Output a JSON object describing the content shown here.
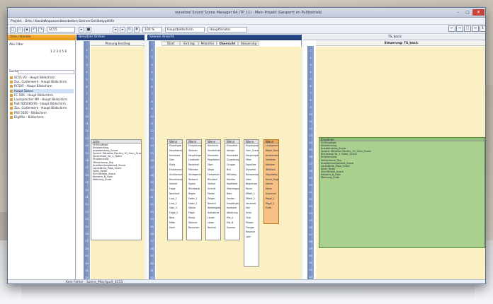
{
  "app": {
    "title": "wavetool Sound Scene Manager 64 (TP 11) - Mein Projekt (Gesperrt im Pultbetrieb)",
    "window_controls": [
      "–",
      "□",
      "✕"
    ]
  },
  "menu": [
    "Projekt",
    "Orte / Kanäle",
    "Anpassen",
    "Bearbeiten",
    "Szenen",
    "Gerätetyp",
    "Hilfe"
  ],
  "toolbar": {
    "scene_combo": "SC55",
    "zoom_combo": "100 %",
    "lang_combo": "Hauptbildschirm",
    "mode_combo": "Hauptfenster"
  },
  "left_panel": {
    "header": "Orte / Kanäle",
    "filter_label": "Alle Filter",
    "channel_counter": "1 2 3 4 5 6",
    "search_label": "Suche",
    "tree": [
      {
        "label": "SC55 V2 - Haupt Bildschirm",
        "selected": false
      },
      {
        "label": "Zus. Codierwerk - Haupt Bildschirm",
        "selected": false
      },
      {
        "label": "RC505 - Haupt Bildschirm",
        "selected": false
      },
      {
        "label": "Haupt Szene",
        "selected": true
      },
      {
        "label": "FC-505 - Haupt Bildschirm",
        "selected": false
      },
      {
        "label": "Lautsprecher MP - Haupt Bildschirm",
        "selected": false
      },
      {
        "label": "Pult RD5000/S5 - Haupt Bildschirm",
        "selected": false
      },
      {
        "label": "Zus. Codierwerk - Haupt Bildschirm",
        "selected": false
      },
      {
        "label": "PSS 5050 - Bildschirm",
        "selected": false
      },
      {
        "label": "DigiMix - Bildschirm",
        "selected": false
      }
    ]
  },
  "mid_panel": {
    "header": "Benutzer Ordner",
    "column_header": "Planung Einstieg",
    "box": {
      "title": "Liste",
      "items": [
        "Hi Eingänge",
        "Einblendung",
        "Ausblendung_Score",
        "Sprech Mikrofon Rechts_10_Gain_Score",
        "Sprechtest_Nr_1_Fader",
        "Einblendung",
        "Fehlstimme_Tag",
        "Ausblendungsband_Score",
        "Lautstärke_Pass_Score",
        "Spiel_Fader",
        "Schnittliste_Score",
        "Kamera_B_Gain",
        "Meldung_Ende"
      ]
    }
  },
  "center_panel": {
    "header": "Szenen Ansicht",
    "tabs": [
      "Start",
      "Eintrag",
      "Mikrofon",
      "Übersicht",
      "Steuerung"
    ],
    "active_tab": "Steuerung",
    "boxes": [
      {
        "title": "Wenn",
        "items": [
          "Pauseligab",
          "Hauptkanal",
          "Kanalsatz",
          "Gain",
          "Stufe",
          "Einblendung",
          "Ausblendung",
          "Raumklang",
          "Vorlauf",
          "Folge",
          "Nachlauf",
          "Laut_1",
          "Laut_2",
          "Gain_3",
          "Folge_2",
          "Bass",
          "Mitte",
          "Hoch"
        ]
      },
      {
        "title": "Wenn",
        "items": [
          "Einspielung",
          "Textsatz",
          "Hauptfolge",
          "Lautstufe",
          "Raumhall",
          "Mikrofon",
          "Verzögerung",
          "Tonband",
          "Signal",
          "Rückkanal",
          "Regler",
          "Fader_1",
          "Fader_2",
          "Steller",
          "Pegel",
          "Klang",
          "Stimme",
          "Rauschen"
        ]
      },
      {
        "title": "Wenn",
        "items": [
          "Nachricht",
          "Senderliste",
          "Kanalsatz",
          "Pegelband",
          "Start",
          "Stopp",
          "Fortsetzen",
          "Rücklauf",
          "Vorlauf",
          "Schnitt",
          "Marke",
          "Zeiger",
          "Bereich",
          "Wiedergabe",
          "Aufnahme",
          "Lauter",
          "Leiser",
          "Neutral"
        ]
      },
      {
        "title": "Wenn",
        "items": [
          "Einspieler",
          "Ablage",
          "Kanalwahl",
          "Zuweisung",
          "Gruppe",
          "Bus",
          "Hilfsweg",
          "Monitor",
          "Kopfhörer",
          "Übertragung",
          "Netz",
          "Sender",
          "Empfänger",
          "Kontrolle",
          "Abhörung",
          "Mix_A",
          "Mix_B",
          "Summe"
        ]
      },
      {
        "title": "Wenn",
        "items": [
          "Eingangswahl",
          "Gain_Score",
          "Hauptregler",
          "Filter",
          "Equalizer",
          "Dynamik",
          "Kompressor",
          "Gate",
          "Begrenzer",
          "Raum",
          "Effekt_1",
          "Effekt_2",
          "Verzerrer",
          "Hall",
          "Echo",
          "Chor",
          "Phaser",
          "Flanger",
          "Reserve",
          "Leer"
        ]
      },
      {
        "title": "Wenn",
        "items": [
          "Lautsprecher",
          "Regie_Score",
          "Ausblendung",
          "Vorhören",
          "Abhören",
          "Talkback",
          "Signalweg",
          "Kanal_Folge",
          "Stereo",
          "Mono",
          "Surround",
          "Pegel_1",
          "Pegel_2",
          "Ende"
        ],
        "highlight": true
      }
    ]
  },
  "right_panel": {
    "tab_title": "TS_basic",
    "panel_title": "Steuerung: TS_basic",
    "buttons": [
      "⇐",
      "⇒",
      "▢",
      "⇔",
      "⇕"
    ],
    "box": {
      "title": "Eingänge",
      "items": [
        "Hi Eingänge",
        "Einblendung",
        "Ausblendung_Score",
        "Sprech Mikrofon Rechts_10_Gain_Score",
        "Rückkanal Nr_1 Fader_Score",
        "Einblendung",
        "Fehlstimme_Tag",
        "Ausblendungsband_Score",
        "Lautstärke_Pass_Score",
        "Spiel_Fader",
        "Schnittliste_Score",
        "Kamera_B_Gain",
        "Meldung_Ende"
      ]
    }
  },
  "ruler_numbers": [
    "1",
    "2",
    "3",
    "4",
    "5",
    "6",
    "7",
    "8",
    "9",
    "10",
    "11",
    "12",
    "13",
    "14",
    "15",
    "16",
    "17",
    "18",
    "19",
    "20",
    "21",
    "22",
    "23",
    "24",
    "25",
    "26",
    "27",
    "28",
    "29",
    "30",
    "31",
    "32",
    "33",
    "34",
    "35",
    "36",
    "37",
    "38",
    "39",
    "40",
    "41"
  ],
  "status": "Kein Fehler · Szene_Mischpult_SC55",
  "colors": {
    "panel_header": "#1e3a73",
    "accent_orange": "#f0a95c",
    "canvas_yellow": "#fbf0c3",
    "box_green": "#a9d08e"
  }
}
